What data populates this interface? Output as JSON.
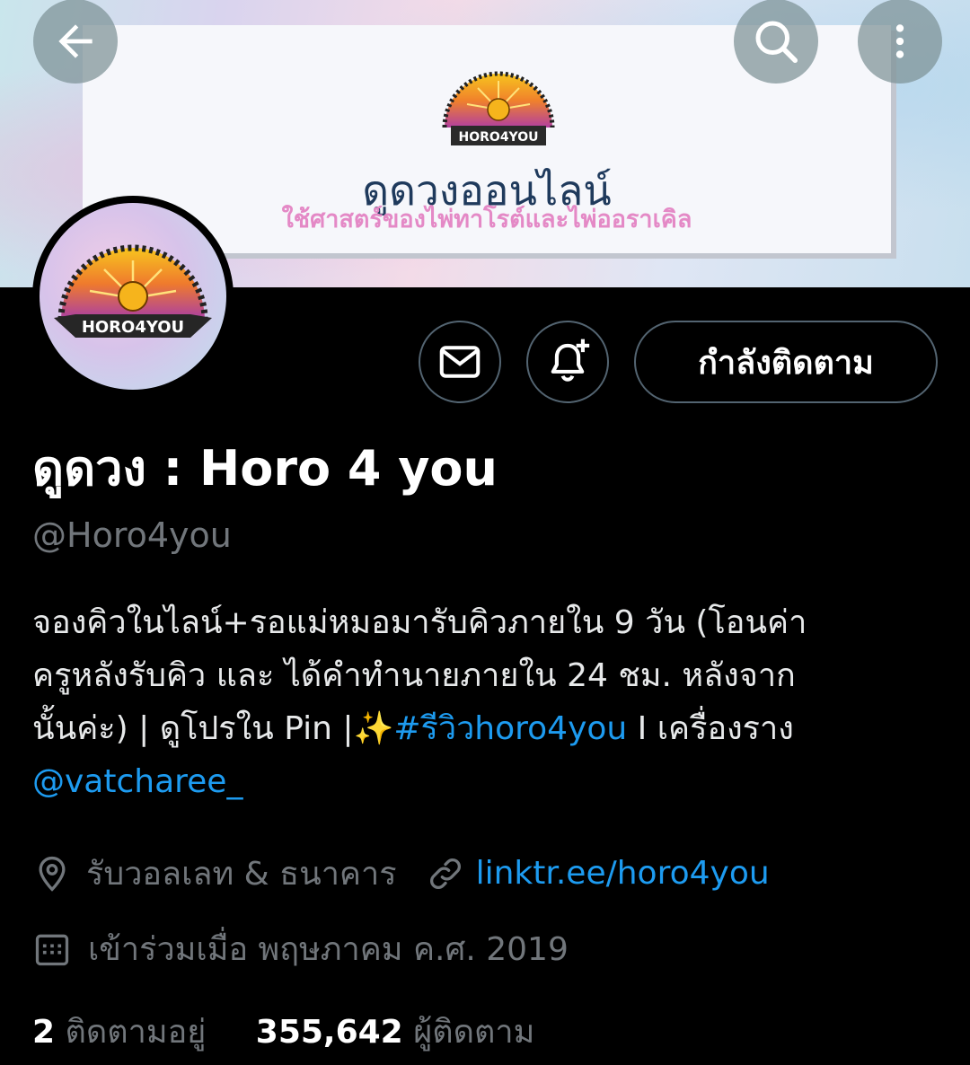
{
  "banner": {
    "logo_text": "HORO4YOU",
    "title": "ดูดวงออนไลน์",
    "subtitle": "ใช้ศาสตร์ของไพ่ทาโรต์และไพ่ออราเคิล"
  },
  "top_bar": {
    "back_icon": "arrow-left-icon",
    "search_icon": "search-icon",
    "more_icon": "more-vertical-icon"
  },
  "avatar": {
    "logo_text": "HORO4YOU"
  },
  "actions": {
    "message_icon": "mail-icon",
    "notify_icon": "bell-plus-icon",
    "follow_label": "กำลังติดตาม"
  },
  "profile": {
    "name": "ดูดวง : Horo 4 you",
    "handle": "@Horo4you",
    "bio": {
      "line1": "จองคิวในไลน์+รอแม่หมอมารับคิวภายใน 9 วัน (โอนค่า",
      "line2": "ครูหลังรับคิว และ ได้คำทำนายภายใน 24 ชม. หลังจาก",
      "line3_text": "นั้นค่ะ) | ดูโปรใน Pin |",
      "line3_emoji": "✨",
      "line3_hashtag": "#รีวิวhoro4you",
      "line3_tail": " I เครื่องราง",
      "line4_mention": "@vatcharee_"
    },
    "location": "รับวอลเลท & ธนาคาร",
    "website": "linktr.ee/horo4you",
    "joined": "เข้าร่วมเมื่อ พฤษภาคม ค.ศ. 2019",
    "following_count": "2",
    "following_label": "ติดตามอยู่",
    "followers_count": "355,642",
    "followers_label": "ผู้ติดตาม"
  },
  "colors": {
    "background": "#000000",
    "link": "#1d9bf0",
    "muted": "#71767b",
    "border": "#536471"
  }
}
